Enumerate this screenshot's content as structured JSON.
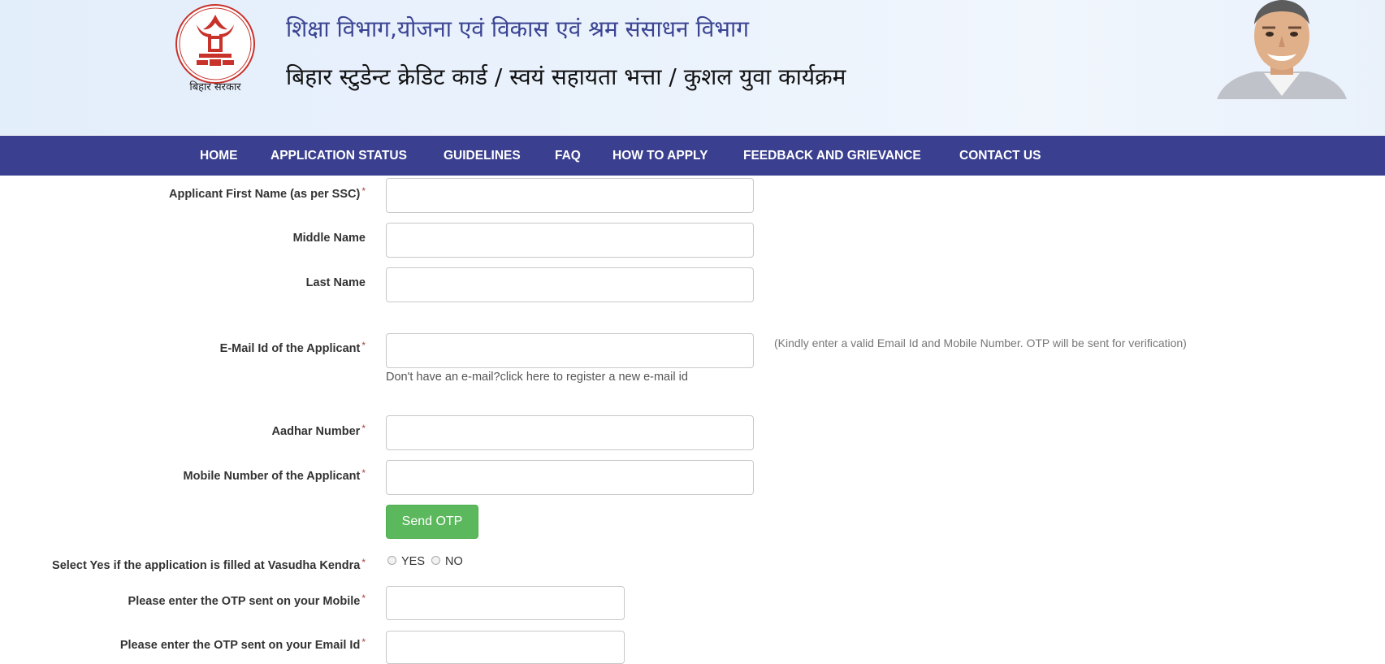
{
  "header": {
    "emblem_caption": "बिहार सरकार",
    "title_line1": "शिक्षा विभाग,योजना एवं विकास एवं श्रम संसाधन विभाग",
    "title_line2": "बिहार स्टुडेन्ट क्रेडिट कार्ड / स्वयं सहायता भत्ता / कुशल युवा कार्यक्रम"
  },
  "nav": {
    "items": [
      "HOME",
      "APPLICATION STATUS",
      "GUIDELINES",
      "FAQ",
      "HOW TO APPLY",
      "FEEDBACK AND GRIEVANCE",
      "CONTACT US"
    ]
  },
  "form": {
    "first_name_label": "Applicant First Name (as per SSC)",
    "middle_name_label": "Middle Name",
    "last_name_label": "Last Name",
    "email_label": "E-Mail Id of the Applicant",
    "email_register_hint": "Don't have an e-mail?click here to register a new e-mail id",
    "email_help": "(Kindly enter a valid Email Id and Mobile Number. OTP will be sent for verification)",
    "aadhar_label": "Aadhar Number",
    "mobile_label": "Mobile Number of the Applicant",
    "send_otp_label": "Send OTP",
    "vasudha_label": "Select Yes if the application is filled at Vasudha Kendra",
    "vasudha_yes": "YES",
    "vasudha_no": "NO",
    "otp_mobile_label": "Please enter the OTP sent on your Mobile",
    "otp_email_label": "Please enter the OTP sent on your Email Id",
    "required_mark": "*"
  },
  "colors": {
    "navbar": "#3a3f8f",
    "title": "#3b4493",
    "button": "#5cb85c"
  },
  "icons": {
    "emblem": "bihar-government-emblem-icon",
    "portrait": "chief-minister-portrait"
  }
}
